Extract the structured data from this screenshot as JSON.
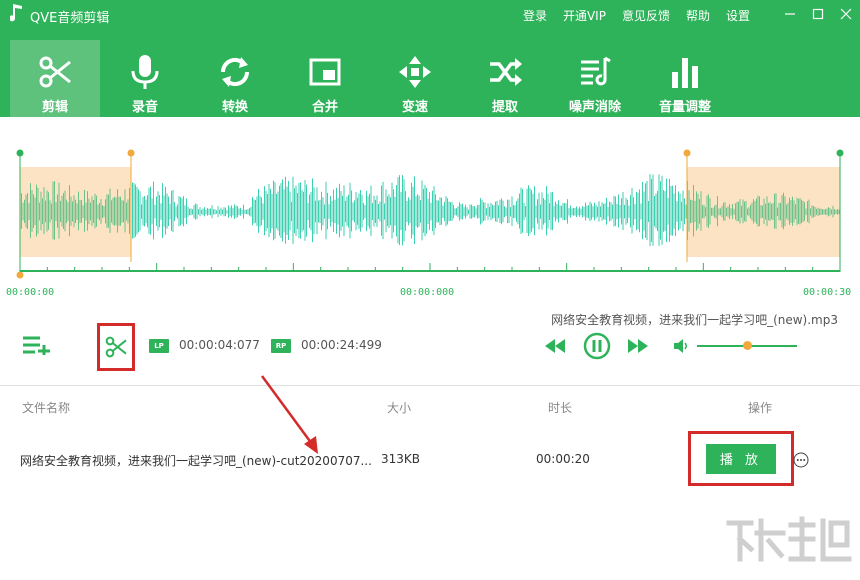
{
  "window": {
    "title": "QVE音频剪辑",
    "links": [
      "登录",
      "开通VIP",
      "意见反馈",
      "帮助",
      "设置"
    ]
  },
  "tabs": [
    {
      "label": "剪辑",
      "icon": "scissors-icon",
      "active": true
    },
    {
      "label": "录音",
      "icon": "microphone-icon",
      "active": false
    },
    {
      "label": "转换",
      "icon": "convert-icon",
      "active": false
    },
    {
      "label": "合并",
      "icon": "merge-icon",
      "active": false
    },
    {
      "label": "变速",
      "icon": "speed-icon",
      "active": false
    },
    {
      "label": "提取",
      "icon": "extract-icon",
      "active": false
    },
    {
      "label": "噪声消除",
      "icon": "noise-icon",
      "active": false
    },
    {
      "label": "音量调整",
      "icon": "volume-bars-icon",
      "active": false
    }
  ],
  "timeline": {
    "start": "00:00:00",
    "current": "00:00:000",
    "end": "00:00:30"
  },
  "controls": {
    "lp_badge": "LP",
    "lp_time": "00:00:04:077",
    "rp_badge": "RP",
    "rp_time": "00:00:24:499",
    "current_file": "网络安全教育视频，进来我们一起学习吧_(new).mp3",
    "volume_level": 0.5
  },
  "table": {
    "headers": {
      "name": "文件名称",
      "size": "大小",
      "duration": "时长",
      "action": "操作"
    },
    "rows": [
      {
        "name": "网络安全教育视频，进来我们一起学习吧_(new)-cut20200707...",
        "size": "313KB",
        "duration": "00:00:20",
        "action_label": "播 放"
      }
    ]
  },
  "colors": {
    "brand": "#2fb35a",
    "tab_active": "#5ec27d",
    "selection": "#fbe3c3",
    "marker": "#f2a83b",
    "highlight": "#d32a2a",
    "wave": "#3ccfb2"
  }
}
